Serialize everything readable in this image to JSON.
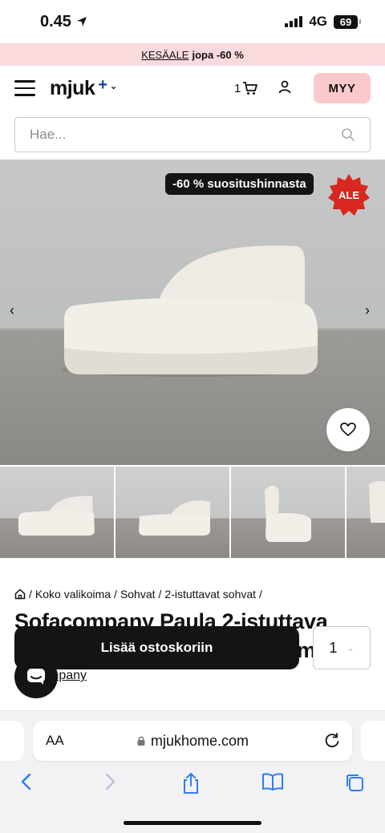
{
  "status": {
    "time": "0.45",
    "network": "4G",
    "battery": "69"
  },
  "promo": {
    "code": "KESÄALE",
    "text": "jopa -60 %"
  },
  "header": {
    "logo": "mjuk",
    "cart_count": "1",
    "sell_label": "MYY"
  },
  "search": {
    "placeholder": "Hae..."
  },
  "hero": {
    "discount_badge": "-60 % suositushinnasta",
    "sale_label": "ALE"
  },
  "breadcrumb": {
    "items": [
      "Koko valikoima",
      "Sohvat",
      "2-istuttavat sohvat"
    ]
  },
  "product": {
    "title": "Sofacompany Paula 2-istuttava",
    "title_tail": "me",
    "brand_visible": "mpany"
  },
  "actions": {
    "add_to_cart_label": "Lisää ostoskoriin",
    "quantity": "1"
  },
  "browser": {
    "aa_label": "AA",
    "url": "mjukhome.com"
  },
  "colors": {
    "promo_bg": "#fadadd",
    "sell_bg": "#fbc9cc",
    "sale_red": "#d8271f",
    "flag_blue": "#1a3ea6"
  }
}
